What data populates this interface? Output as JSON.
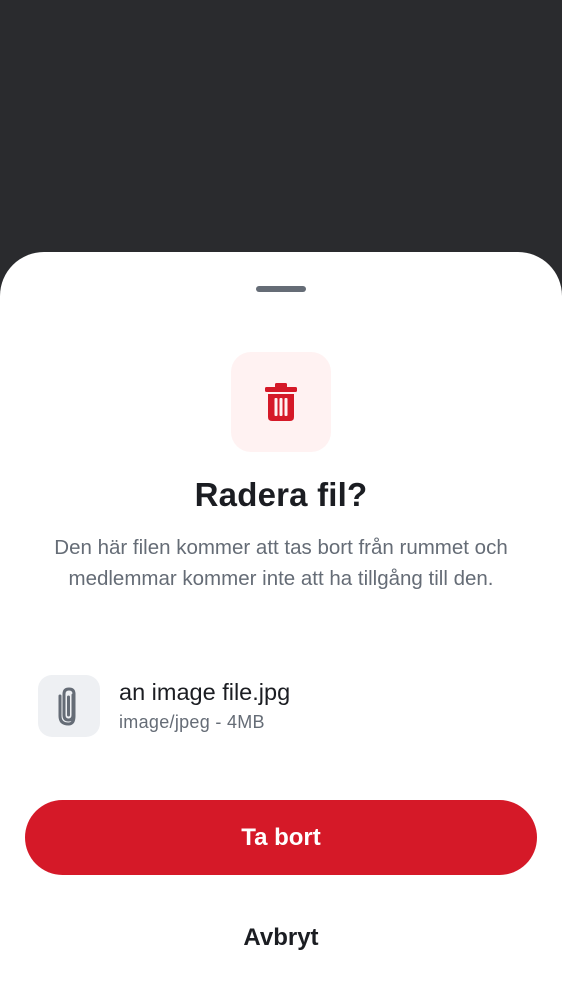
{
  "dialog": {
    "title": "Radera fil?",
    "message": "Den här filen kommer att tas bort från rummet och medlemmar kommer inte att ha tillgång till den.",
    "icon": "trash-icon",
    "accent_color": "#d51928",
    "icon_tile_color": "#fff2f2"
  },
  "file": {
    "name": "an image file.jpg",
    "meta": "image/jpeg - 4MB",
    "icon": "paperclip-icon"
  },
  "actions": {
    "delete_label": "Ta bort",
    "cancel_label": "Avbryt"
  }
}
